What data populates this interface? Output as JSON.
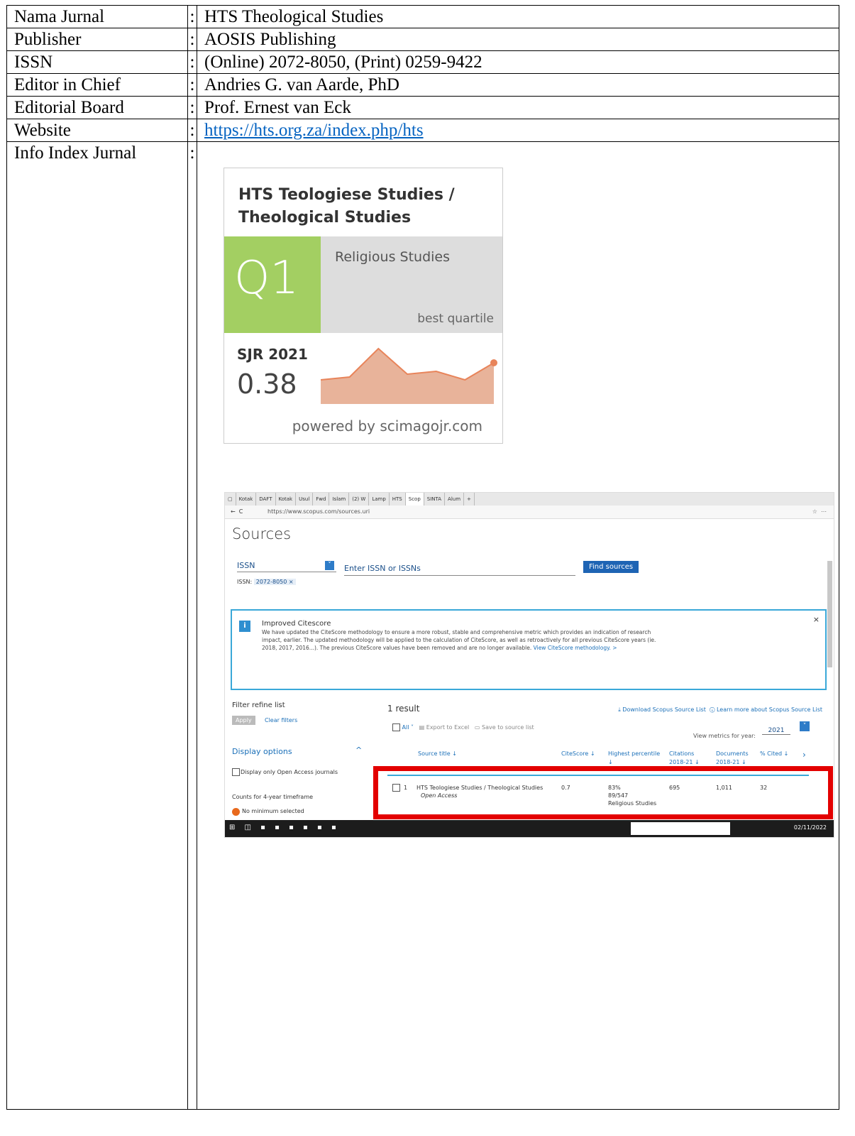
{
  "rows": [
    {
      "label": "Nama Jurnal",
      "sep": ":",
      "value": "HTS Theological Studies"
    },
    {
      "label": "Publisher",
      "sep": ":",
      "value": "AOSIS Publishing"
    },
    {
      "label": "ISSN",
      "sep": ":",
      "value": "(Online) 2072-8050, (Print) 0259-9422"
    },
    {
      "label": "Editor in Chief",
      "sep": ":",
      "value": "Andries G. van Aarde, PhD"
    },
    {
      "label": "Editorial Board",
      "sep": ":",
      "value": "Prof. Ernest van Eck"
    },
    {
      "label": "Website",
      "sep": ":",
      "value": "https://hts.org.za/index.php/hts"
    },
    {
      "label": "Info Index Jurnal",
      "sep": ":"
    }
  ],
  "sjr_widget": {
    "title_line1": "HTS Teologiese Studies /",
    "title_line2": "Theological Studies",
    "quartile": "Q1",
    "category": "Religious Studies",
    "quartile_label": "best quartile",
    "sjr_year": "SJR 2021",
    "sjr_value": "0.38",
    "powered_by": "powered by scimagojr.com",
    "colors": {
      "quartile_bg": "#a3cf62",
      "category_bg": "#dddddd",
      "trend_line": "#e8845a",
      "trend_fill": "#e8b39a"
    },
    "trend": [
      0.32,
      0.33,
      0.43,
      0.34,
      0.35,
      0.32,
      0.38
    ]
  },
  "scopus": {
    "tabs": [
      "Kotak",
      "DAFT",
      "Kotak",
      "Usul",
      "Fwd",
      "Islam",
      "(2) W",
      "Lamp",
      "HTS",
      "Scop",
      "SINTA",
      "Alum"
    ],
    "url": "https://www.scopus.com/sources.uri",
    "page_title": "Sources",
    "issn_label": "ISSN",
    "issn_placeholder": "Enter ISSN or ISSNs",
    "find_button": "Find sources",
    "issn_chip_label": "ISSN:",
    "issn_chip_value": "2072-8050 ×",
    "notice_title": "Improved Citescore",
    "notice_body": "We have updated the CiteScore methodology to ensure a more robust, stable and comprehensive metric which provides an indication of research impact, earlier. The updated methodology will be applied to the calculation of CiteScore, as well as retroactively for all previous CiteScore years (ie. 2018, 2017, 2016...). The previous CiteScore values have been removed and are no longer available.",
    "notice_link": "View CiteScore methodology. >",
    "filter_title": "Filter refine list",
    "apply": "Apply",
    "clear_filters": "Clear filters",
    "display_options": "Display options",
    "open_access_only": "Display only Open Access journals",
    "counts_label": "Counts for 4-year timeframe",
    "no_minimum": "No minimum selected",
    "result_count": "1 result",
    "download_link": "Download Scopus Source List",
    "learn_more": "Learn more about Scopus Source List",
    "all_label": "All",
    "export_excel": "Export to Excel",
    "save_list": "Save to source list",
    "view_metrics": "View metrics for year:",
    "year": "2021",
    "columns": [
      "Source title ↓",
      "CiteScore ↓",
      "Highest percentile ↓",
      "Citations 2018-21 ↓",
      "Documents 2018-21 ↓",
      "% Cited ↓"
    ],
    "result": {
      "num": "1",
      "title": "HTS Teologiese Studies / Theological Studies",
      "open_access": "Open Access",
      "citescore": "0.7",
      "percentile": "83%",
      "rank": "89/547",
      "category": "Religious Studies",
      "citations": "695",
      "documents": "1,011",
      "cited": "32"
    },
    "taskbar_date": "02/11/2022",
    "highlight_color": "#e30000"
  }
}
